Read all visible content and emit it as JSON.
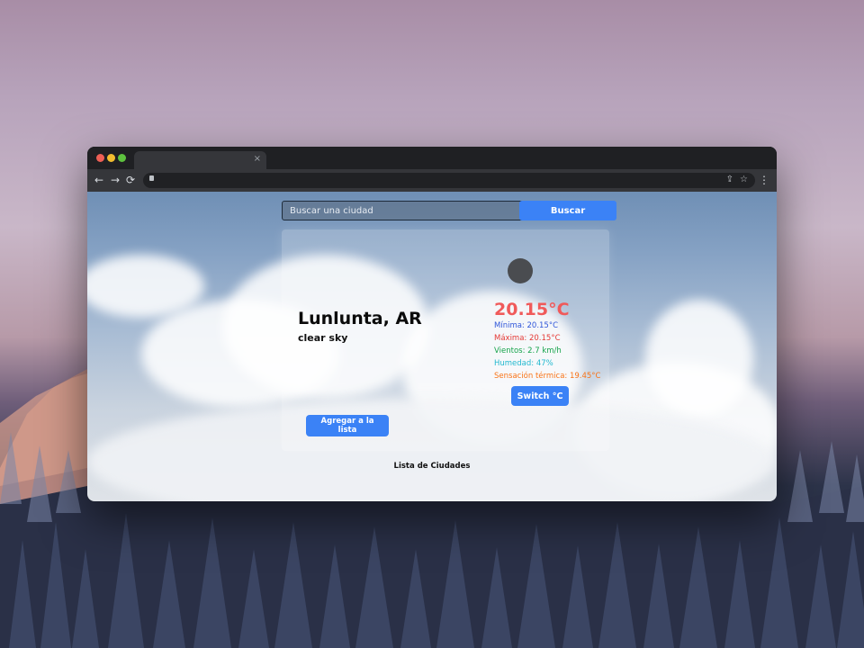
{
  "browser": {
    "tab_close": "×",
    "nav": {
      "back": "←",
      "forward": "→",
      "reload": "⟳"
    },
    "icons": {
      "share": "share-icon",
      "bookmark": "star-icon",
      "menu": "more-vert-icon",
      "lock": "lock-icon"
    }
  },
  "search": {
    "placeholder": "Buscar una ciudad",
    "button_label": "Buscar"
  },
  "weather": {
    "city": "Lunlunta, AR",
    "description": "clear sky",
    "temperature": "20.15°C",
    "min": "Mínima: 20.15°C",
    "max": "Máxima: 20.15°C",
    "wind": "Vientos: 2.7 km/h",
    "humidity": "Humedad: 47%",
    "feels_like": "Sensación térmica: 19.45°C",
    "switch_label": "Switch °C",
    "add_label": "Agregar a la lista",
    "icon": "weather-icon"
  },
  "list": {
    "title": "Lista de Ciudades"
  },
  "colors": {
    "accent": "#3b82f6",
    "temperature": "#f05a5a",
    "min": "#2f56d9",
    "max": "#e53935",
    "wind": "#16a34a",
    "humidity": "#22b8cf",
    "feels_like": "#f97316"
  }
}
